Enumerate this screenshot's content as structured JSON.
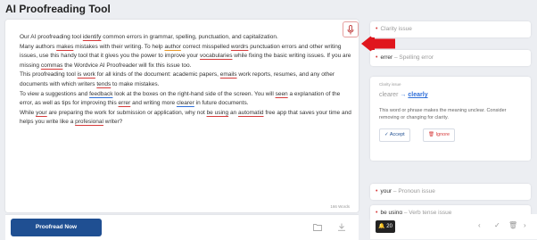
{
  "app": {
    "title": "AI Proofreading Tool"
  },
  "editor": {
    "paragraphs": [
      [
        {
          "t": "Our AI proofreading tool "
        },
        {
          "t": "identify",
          "u": "r"
        },
        {
          "t": " common errors in grammar, spelling, punctuation, and capitalization."
        }
      ],
      [
        {
          "t": "Many authors "
        },
        {
          "t": "makes",
          "u": "r"
        },
        {
          "t": " mistakes with their writing. To help "
        },
        {
          "t": "author",
          "u": "o"
        },
        {
          "t": " correct misspelled "
        },
        {
          "t": "wordrs",
          "u": "r"
        },
        {
          "t": " punctuation errors and other writing issues, use this handy tool that it gives you the power to improve your "
        },
        {
          "t": "vocabularies",
          "u": "r"
        },
        {
          "t": " while fixing the basic writing issues. If you are missing "
        },
        {
          "t": "commas",
          "u": "r"
        },
        {
          "t": " the Wordvice AI Proofreader will fix this issue too."
        }
      ],
      [
        {
          "t": "This proofreading tool "
        },
        {
          "t": "is work",
          "u": "r"
        },
        {
          "t": " for all kinds of the document: academic papers, "
        },
        {
          "t": "emails",
          "u": "r"
        },
        {
          "t": " work reports, resumes, and any other documents with which writers "
        },
        {
          "t": "tends",
          "u": "r"
        },
        {
          "t": " to make mistakes."
        }
      ],
      [
        {
          "t": "To view a suggestions and "
        },
        {
          "t": "feedback",
          "u": "b"
        },
        {
          "t": " look at the boxes on the right-hand side of the screen. You will "
        },
        {
          "t": "seen",
          "u": "r"
        },
        {
          "t": " a explanation of the error, as well as tips for improving this "
        },
        {
          "t": "errer",
          "u": "r"
        },
        {
          "t": " and writing more "
        },
        {
          "t": "clearer",
          "u": "b"
        },
        {
          "t": " in future documents."
        }
      ],
      [
        {
          "t": "While "
        },
        {
          "t": "your",
          "u": "r"
        },
        {
          "t": " are preparing the work for submission or application, why not "
        },
        {
          "t": "be using",
          "u": "r"
        },
        {
          "t": " an "
        },
        {
          "t": "automatid",
          "u": "r"
        },
        {
          "t": " free app that saves your time and helps you write like a "
        },
        {
          "t": "profesional",
          "u": "r"
        },
        {
          "t": " writer?"
        }
      ]
    ],
    "word_count": "166 Words",
    "proofread_label": "Proofread Now"
  },
  "panel": {
    "cards": [
      {
        "word": "",
        "type": "Clarity issue"
      },
      {
        "word": "errer",
        "type": "Spelling error"
      }
    ],
    "expanded": {
      "label": "Clarity issue",
      "old": "clearer",
      "new": "clearly",
      "description": "This word or phrase makes the meaning unclear. Consider removing or changing for clarity.",
      "accept_label": "Accept",
      "ignore_label": "Ignore"
    },
    "cards_below": [
      {
        "word": "your",
        "type": "Pronoun issue"
      },
      {
        "word": "be using",
        "type": "Verb tense issue"
      }
    ],
    "issue_count": "20"
  },
  "colors": {
    "accent": "#1f4f92",
    "error": "#d63b3b",
    "clarity": "#2f6fd9",
    "arrow": "#e0161d"
  }
}
